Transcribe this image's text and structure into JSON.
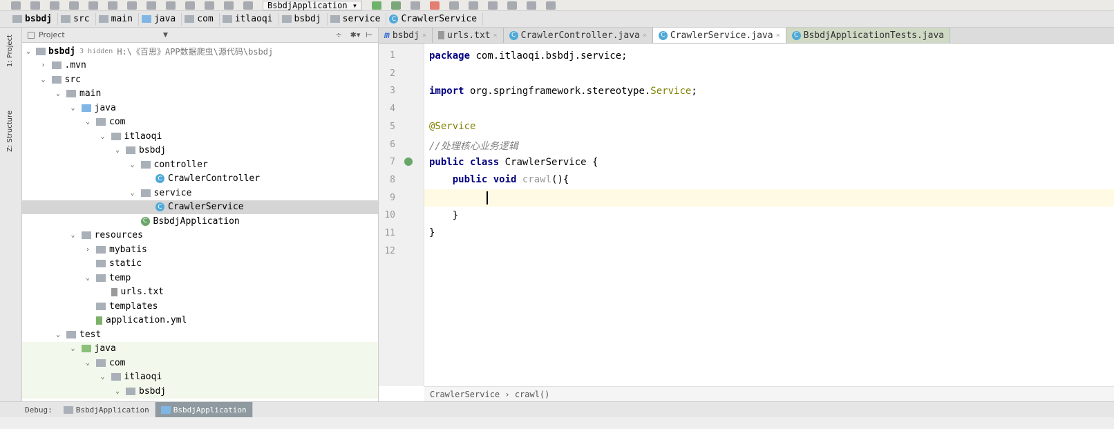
{
  "toolbar": {
    "run_config": "BsbdjApplication ▾"
  },
  "breadcrumb": [
    {
      "label": "bsbdj",
      "icon": "module"
    },
    {
      "label": "src",
      "icon": "folder"
    },
    {
      "label": "main",
      "icon": "folder"
    },
    {
      "label": "java",
      "icon": "source-folder"
    },
    {
      "label": "com",
      "icon": "package"
    },
    {
      "label": "itlaoqi",
      "icon": "package"
    },
    {
      "label": "bsbdj",
      "icon": "package"
    },
    {
      "label": "service",
      "icon": "package"
    },
    {
      "label": "CrawlerService",
      "icon": "class"
    }
  ],
  "side_tabs": [
    "1: Project",
    "Z: Structure"
  ],
  "project": {
    "title": "Project",
    "root": {
      "label": "bsbdj",
      "hint": "3 hidden",
      "path": "H:\\《百思》APP数据爬虫\\源代码\\bsbdj"
    },
    "items": [
      {
        "label": ".mvn",
        "depth": 1,
        "arrow": "›",
        "icon": "folder"
      },
      {
        "label": "src",
        "depth": 1,
        "arrow": "⌄",
        "icon": "folder"
      },
      {
        "label": "main",
        "depth": 2,
        "arrow": "⌄",
        "icon": "folder"
      },
      {
        "label": "java",
        "depth": 3,
        "arrow": "⌄",
        "icon": "source-folder"
      },
      {
        "label": "com",
        "depth": 4,
        "arrow": "⌄",
        "icon": "package"
      },
      {
        "label": "itlaoqi",
        "depth": 5,
        "arrow": "⌄",
        "icon": "package"
      },
      {
        "label": "bsbdj",
        "depth": 6,
        "arrow": "⌄",
        "icon": "package"
      },
      {
        "label": "controller",
        "depth": 7,
        "arrow": "⌄",
        "icon": "package"
      },
      {
        "label": "CrawlerController",
        "depth": 8,
        "arrow": "",
        "icon": "class"
      },
      {
        "label": "service",
        "depth": 7,
        "arrow": "⌄",
        "icon": "package"
      },
      {
        "label": "CrawlerService",
        "depth": 8,
        "arrow": "",
        "icon": "class",
        "selected": true
      },
      {
        "label": "BsbdjApplication",
        "depth": 7,
        "arrow": "",
        "icon": "spring-class"
      },
      {
        "label": "resources",
        "depth": 3,
        "arrow": "⌄",
        "icon": "resources-folder"
      },
      {
        "label": "mybatis",
        "depth": 4,
        "arrow": "›",
        "icon": "folder"
      },
      {
        "label": "static",
        "depth": 4,
        "arrow": "",
        "icon": "folder"
      },
      {
        "label": "temp",
        "depth": 4,
        "arrow": "⌄",
        "icon": "folder"
      },
      {
        "label": "urls.txt",
        "depth": 5,
        "arrow": "",
        "icon": "text-file"
      },
      {
        "label": "templates",
        "depth": 4,
        "arrow": "",
        "icon": "folder"
      },
      {
        "label": "application.yml",
        "depth": 4,
        "arrow": "",
        "icon": "yml-file"
      },
      {
        "label": "test",
        "depth": 2,
        "arrow": "⌄",
        "icon": "folder"
      },
      {
        "label": "java",
        "depth": 3,
        "arrow": "⌄",
        "icon": "test-folder",
        "test": true
      },
      {
        "label": "com",
        "depth": 4,
        "arrow": "⌄",
        "icon": "package",
        "test": true
      },
      {
        "label": "itlaoqi",
        "depth": 5,
        "arrow": "⌄",
        "icon": "package",
        "test": true
      },
      {
        "label": "bsbdj",
        "depth": 6,
        "arrow": "⌄",
        "icon": "package",
        "test": true
      }
    ]
  },
  "tabs": [
    {
      "label": "bsbdj",
      "icon": "maven"
    },
    {
      "label": "urls.txt",
      "icon": "text-file"
    },
    {
      "label": "CrawlerController.java",
      "icon": "class"
    },
    {
      "label": "CrawlerService.java",
      "icon": "class",
      "active": true
    },
    {
      "label": "BsbdjApplicationTests.java",
      "icon": "test-class"
    }
  ],
  "code": {
    "line_numbers": [
      "1",
      "2",
      "3",
      "4",
      "5",
      "6",
      "7",
      "8",
      "9",
      "10",
      "11",
      "12"
    ],
    "line1_kw": "package",
    "line1_rest": " com.itlaoqi.bsbdj.service;",
    "line3_kw": "import",
    "line3_rest": " org.springframework.stereotype.",
    "line3_ann": "Service",
    "line3_end": ";",
    "line5": "@Service",
    "line6": "//处理核心业务逻辑",
    "line7_kw": "public class",
    "line7_rest": " CrawlerService {",
    "line8_kw": "    public void",
    "line8_method": " crawl",
    "line8_rest": "(){",
    "line10": "    }",
    "line11": "}"
  },
  "editor_breadcrumb": "CrawlerService › crawl()",
  "debug": {
    "label": "Debug:",
    "tabs": [
      "BsbdjApplication",
      "BsbdjApplication"
    ]
  }
}
